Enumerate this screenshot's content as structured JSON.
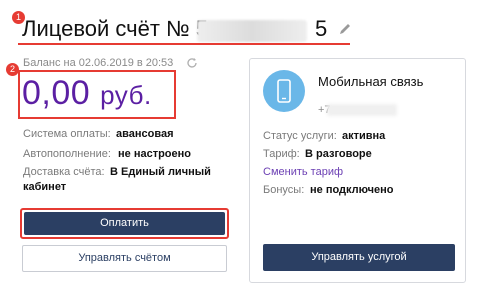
{
  "header": {
    "title_prefix": "Лицевой счёт № 5",
    "title_suffix": "5",
    "markers": [
      "1",
      "2"
    ]
  },
  "balance": {
    "date_label": "Баланс на 02.06.2019 в 20:53",
    "amount": "0,00",
    "currency": "руб."
  },
  "account": {
    "rows": [
      {
        "label": "Система оплаты:",
        "value": "авансовая"
      },
      {
        "label": "Автопополнение:",
        "value": "не настроено"
      },
      {
        "label": "Доставка счёта:",
        "value": "В Единый личный",
        "value_line2": "кабинет"
      }
    ],
    "pay_button": "Оплатить",
    "manage_button": "Управлять счётом"
  },
  "service": {
    "name": "Мобильная связь",
    "phone_prefix": "+7",
    "status_label": "Статус услуги:",
    "status_value": "активна",
    "tariff_label": "Тариф:",
    "tariff_value": "В разговоре",
    "change_tariff_link": "Сменить тариф",
    "bonus_label": "Бонусы:",
    "bonus_value": "не подключено",
    "manage_button": "Управлять услугой"
  },
  "colors": {
    "accent_red": "#e63b33",
    "balance_purple": "#5b1fa3",
    "button_navy": "#2b3f63",
    "icon_blue": "#6ab7e8",
    "link_purple": "#6b3fb3"
  },
  "icons": [
    "edit-icon",
    "refresh-icon",
    "phone-icon"
  ]
}
